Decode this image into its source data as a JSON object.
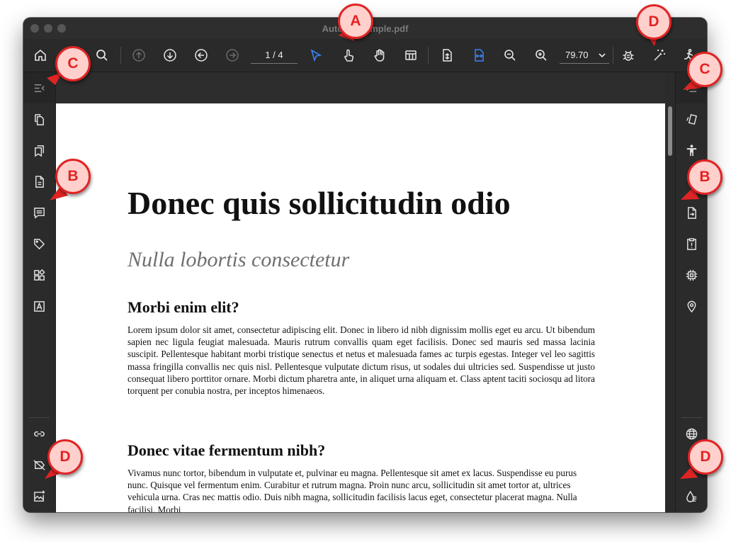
{
  "window": {
    "title": "AutoTagSample.pdf"
  },
  "toolbar": {
    "page_indicator": "1 / 4",
    "zoom_value": "79.70",
    "icons": [
      "home-icon",
      "search-icon",
      "page-up-icon",
      "page-down-icon",
      "prev-page-icon",
      "next-page-icon",
      "select-tool-icon",
      "touch-tool-icon",
      "pan-tool-icon",
      "layout-icon",
      "fit-page-icon",
      "fit-width-icon",
      "zoom-out-icon",
      "zoom-in-icon",
      "bug-icon",
      "magic-wand-icon",
      "run-icon"
    ]
  },
  "left_sidebar": {
    "icons": [
      "collapse-sidebar-icon",
      "thumbnails-icon",
      "bookmarks-icon",
      "document-icon",
      "comments-icon",
      "tags-icon",
      "content-icon",
      "text-icon",
      "link-icon",
      "no-tags-icon",
      "add-image-icon"
    ]
  },
  "right_sidebar": {
    "icons": [
      "collapse-right-sidebar-icon",
      "reading-order-icon",
      "accessibility-icon",
      "export-icon",
      "issues-icon",
      "processor-icon",
      "location-icon",
      "language-icon",
      "alt-text-icon"
    ]
  },
  "document": {
    "title": "Donec quis sollicitudin odio",
    "subtitle": "Nulla lobortis consectetur",
    "section1_heading": "Morbi enim elit?",
    "section1_body": "Lorem ipsum dolor sit amet, consectetur adipiscing elit. Donec in libero id nibh dignissim mollis eget eu arcu. Ut bibendum sapien nec ligula feugiat malesuada. Mauris rutrum convallis quam eget facilisis. Donec sed mauris sed massa lacinia suscipit. Pellentesque habitant morbi tristique senectus et netus et malesuada fames ac turpis egestas. Integer vel leo sagittis massa fringilla convallis nec quis nisl. Pellentesque vulputate dictum risus, ut sodales dui ultricies sed. Suspendisse ut justo consequat libero porttitor ornare. Morbi dictum pharetra ante, in aliquet urna aliquam et. Class aptent taciti sociosqu ad litora torquent per conubia nostra, per inceptos himenaeos.",
    "section2_heading": "Donec vitae fermentum nibh?",
    "section2_body": "Vivamus nunc tortor, bibendum in vulputate et, pulvinar eu magna. Pellentesque sit amet ex lacus. Suspendisse eu purus nunc. Quisque vel fermentum enim. Curabitur et rutrum magna. Proin nunc arcu, sollicitudin sit amet tortor at, ultrices vehicula urna. Cras nec mattis odio. Duis nibh magna, sollicitudin facilisis lacus eget, consectetur placerat magna. Nulla facilisi. Morbi"
  },
  "annotations": {
    "a_label": "A",
    "b_label": "B",
    "c_label": "C",
    "d_label": "D",
    "color": "#e02424"
  },
  "colors": {
    "accent_blue": "#3b82f6",
    "annotation_red": "#e02424"
  }
}
